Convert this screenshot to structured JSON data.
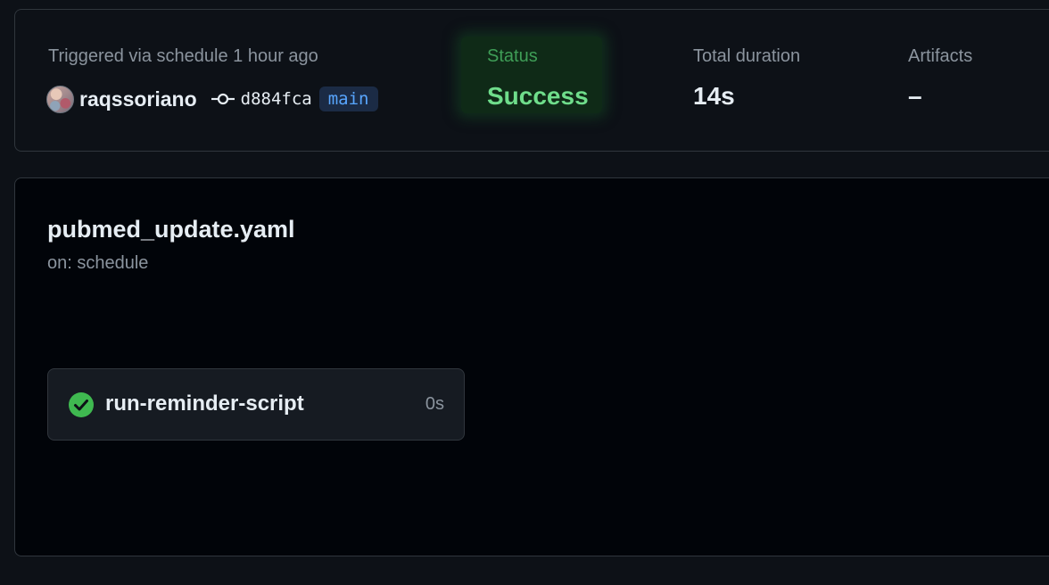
{
  "summary": {
    "trigger": "Triggered via schedule 1 hour ago",
    "actor": "raqssoriano",
    "commit_sha": "d884fca",
    "branch": "main",
    "status_label": "Status",
    "status_value": "Success",
    "duration_label": "Total duration",
    "duration_value": "14s",
    "artifacts_label": "Artifacts",
    "artifacts_value": "–",
    "colors": {
      "success": "#6fdd8b",
      "branch": "#58a6ff"
    }
  },
  "workflow": {
    "file": "pubmed_update.yaml",
    "event": "on: schedule",
    "jobs": [
      {
        "name": "run-reminder-script",
        "duration": "0s",
        "status_icon": "check-circle-icon",
        "status_color": "#3fb950"
      }
    ]
  }
}
